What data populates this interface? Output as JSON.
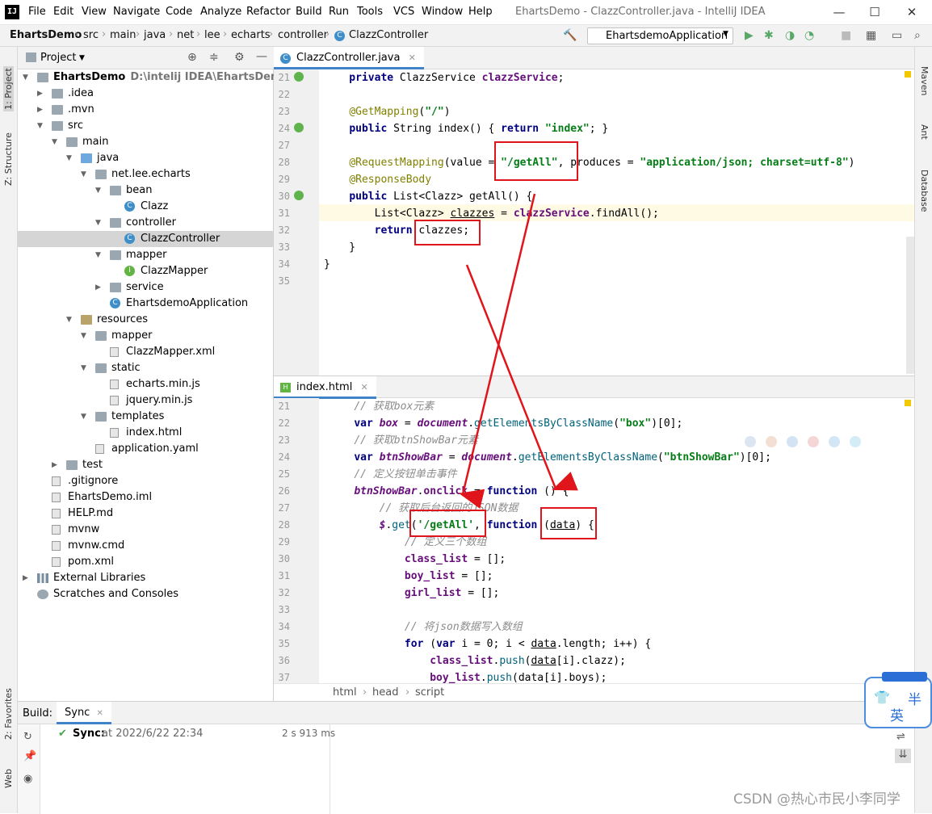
{
  "menubar": {
    "items": [
      "File",
      "Edit",
      "View",
      "Navigate",
      "Code",
      "Analyze",
      "Refactor",
      "Build",
      "Run",
      "Tools",
      "VCS",
      "Window",
      "Help"
    ],
    "title": "EhartsDemo - ClazzController.java - IntelliJ IDEA",
    "logo": "IJ"
  },
  "navbar": {
    "crumbs": [
      "EhartsDemo",
      "src",
      "main",
      "java",
      "net",
      "lee",
      "echarts",
      "controller",
      "ClazzController"
    ],
    "run_config": "EhartsdemoApplication"
  },
  "left_strip": {
    "project": "1: Project",
    "structure": "Z: Structure",
    "favorites": "2: Favorites",
    "web": "Web"
  },
  "right_strip": {
    "maven": "Maven",
    "ant": "Ant",
    "database": "Database"
  },
  "project_panel": {
    "title": "Project",
    "tree": [
      {
        "label": "EhartsDemo",
        "path": "D:\\intelij IDEA\\EhartsDemo",
        "bold": true
      },
      {
        "label": ".idea"
      },
      {
        "label": ".mvn"
      },
      {
        "label": "src"
      },
      {
        "label": "main"
      },
      {
        "label": "java"
      },
      {
        "label": "net.lee.echarts"
      },
      {
        "label": "bean"
      },
      {
        "label": "Clazz"
      },
      {
        "label": "controller"
      },
      {
        "label": "ClazzController"
      },
      {
        "label": "mapper"
      },
      {
        "label": "ClazzMapper"
      },
      {
        "label": "service"
      },
      {
        "label": "EhartsdemoApplication"
      },
      {
        "label": "resources"
      },
      {
        "label": "mapper"
      },
      {
        "label": "ClazzMapper.xml"
      },
      {
        "label": "static"
      },
      {
        "label": "echarts.min.js"
      },
      {
        "label": "jquery.min.js"
      },
      {
        "label": "templates"
      },
      {
        "label": "index.html"
      },
      {
        "label": "application.yaml"
      },
      {
        "label": "test"
      },
      {
        "label": ".gitignore"
      },
      {
        "label": "EhartsDemo.iml"
      },
      {
        "label": "HELP.md"
      },
      {
        "label": "mvnw"
      },
      {
        "label": "mvnw.cmd"
      },
      {
        "label": "pom.xml"
      },
      {
        "label": "External Libraries"
      },
      {
        "label": "Scratches and Consoles"
      }
    ]
  },
  "editor1": {
    "tab": "ClazzController.java",
    "lines": [
      "21",
      "22",
      "23",
      "24",
      "27",
      "28",
      "29",
      "30",
      "31",
      "32",
      "33",
      "34",
      "35"
    ]
  },
  "editor2": {
    "tab": "index.html",
    "lines": [
      "21",
      "22",
      "23",
      "24",
      "25",
      "26",
      "27",
      "28",
      "29",
      "30",
      "31",
      "32",
      "33",
      "34",
      "35",
      "36",
      "37"
    ],
    "breadcrumb": [
      "html",
      "head",
      "script"
    ]
  },
  "build": {
    "label": "Build:",
    "tab": "Sync",
    "status": "Sync:",
    "time_label": "at 2022/6/22 22:34",
    "duration": "2 s 913 ms"
  },
  "ime": {
    "top": "半",
    "bottom": "英"
  },
  "watermark": "CSDN @热心市民小李同学"
}
